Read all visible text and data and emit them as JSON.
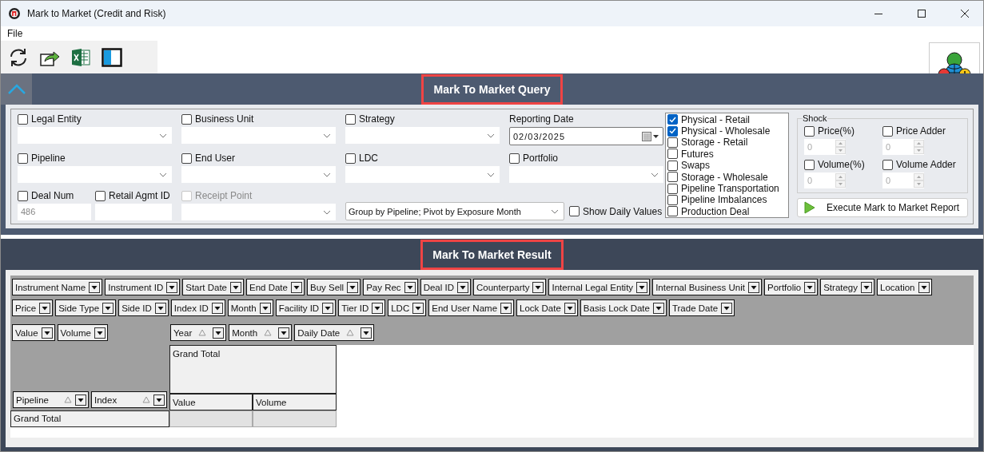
{
  "window": {
    "title": "Mark to Market (Credit and Risk)"
  },
  "menu": [
    "File"
  ],
  "query": {
    "title": "Mark To Market Query",
    "filter_rows": [
      [
        {
          "kind": "combo",
          "label": "Legal Entity",
          "checked": false,
          "disabled": false
        },
        {
          "kind": "combo",
          "label": "Business Unit",
          "checked": false,
          "disabled": false
        },
        {
          "kind": "combo",
          "label": "Strategy",
          "checked": false,
          "disabled": false
        },
        {
          "kind": "date",
          "label": "Reporting Date",
          "value": "02/03/2025"
        }
      ],
      [
        {
          "kind": "combo",
          "label": "Pipeline",
          "checked": false,
          "disabled": false
        },
        {
          "kind": "combo",
          "label": "End User",
          "checked": false,
          "disabled": false
        },
        {
          "kind": "combo",
          "label": "LDC",
          "checked": false,
          "disabled": false
        },
        {
          "kind": "combo",
          "label": "Portfolio",
          "checked": false,
          "disabled": false
        }
      ],
      [
        {
          "kind": "text",
          "label": "Deal Num",
          "checked": false,
          "value": "486"
        },
        {
          "kind": "text",
          "label": "Retail Agmt ID",
          "checked": false
        },
        {
          "kind": "combo",
          "label": "Receipt Point",
          "checked": false,
          "disabled": true
        },
        {
          "kind": "grouping",
          "value": "Group by Pipeline; Pivot by Exposure Month",
          "option": {
            "label": "Show Daily Values",
            "checked": false
          }
        }
      ]
    ],
    "deal_types": [
      {
        "label": "Physical - Retail",
        "checked": true
      },
      {
        "label": "Physical - Wholesale",
        "checked": true
      },
      {
        "label": "Storage - Retail",
        "checked": false
      },
      {
        "label": "Futures",
        "checked": false
      },
      {
        "label": "Swaps",
        "checked": false
      },
      {
        "label": "Storage - Wholesale",
        "checked": false
      },
      {
        "label": "Pipeline Transportation",
        "checked": false
      },
      {
        "label": "Pipeline Imbalances",
        "checked": false
      },
      {
        "label": "Production Deal",
        "checked": false
      }
    ],
    "shock": {
      "title": "Shock",
      "fields": [
        {
          "label": "Price(%)",
          "checked": false,
          "value": "0"
        },
        {
          "label": "Price Adder",
          "checked": false,
          "value": "0"
        },
        {
          "label": "Volume(%)",
          "checked": false,
          "value": "0"
        },
        {
          "label": "Volume Adder",
          "checked": false,
          "value": "0"
        }
      ]
    },
    "execute_button": "Execute Mark to Market Report"
  },
  "result": {
    "title": "Mark To Market Result",
    "filter_fields": [
      [
        "Instrument Name",
        "Instrument ID",
        "Start Date",
        "End Date",
        "Buy Sell",
        "Pay Rec",
        "Deal ID",
        "Counterparty",
        "Internal Legal Entity",
        "Internal Business Unit",
        "Portfolio",
        "Strategy",
        "Location"
      ],
      [
        "Price",
        "Side Type",
        "Side ID",
        "Index ID",
        "Month",
        "Facility ID",
        "Tier ID",
        "LDC",
        "End User Name",
        "Lock Date",
        "Basis Lock Date",
        "Trade Date"
      ]
    ],
    "data_fields": [
      "Value",
      "Volume"
    ],
    "column_fields": [
      "Year",
      "Month",
      "Daily Date"
    ],
    "row_fields": [
      "Pipeline",
      "Index"
    ],
    "column_header": "Grand Total",
    "data_headers": [
      "Value",
      "Volume"
    ],
    "row_total": "Grand Total"
  }
}
